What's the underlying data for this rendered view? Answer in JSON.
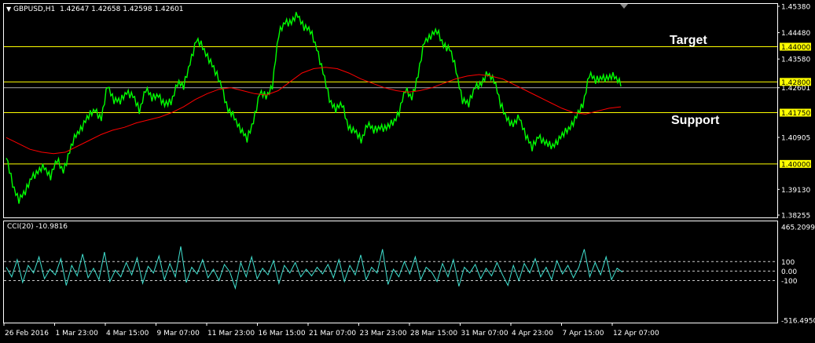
{
  "header": {
    "symbol": "GBPUSD,H1",
    "quotes": "1.42647 1.42658 1.42598 1.42601",
    "indicator": "CCI(20) -10.9816"
  },
  "annotations": {
    "target": "Target",
    "support": "Support"
  },
  "colors": {
    "price": "#00ff00",
    "ma": "#ff0000",
    "cci": "#40e0d0",
    "level": "#ffff00",
    "axis": "#ffffff"
  },
  "chart_data": {
    "type": "line",
    "x_labels": [
      "26 Feb 2016",
      "1 Mar 23:00",
      "4 Mar 15:00",
      "9 Mar 07:00",
      "11 Mar 23:00",
      "16 Mar 15:00",
      "21 Mar 07:00",
      "23 Mar 23:00",
      "28 Mar 15:00",
      "31 Mar 07:00",
      "4 Apr 23:00",
      "7 Apr 15:00",
      "12 Apr 07:00"
    ],
    "price_axis": {
      "ylim": [
        1.38255,
        1.4538
      ],
      "ticks": [
        "1.45380",
        "1.44480",
        "1.43580",
        "1.42601",
        "1.40905",
        "1.39130",
        "1.38255"
      ]
    },
    "levels": [
      {
        "value": 1.44,
        "label": "1.44000"
      },
      {
        "value": 1.428,
        "label": "1.42800"
      },
      {
        "value": 1.4175,
        "label": "1.41750"
      },
      {
        "value": 1.4,
        "label": "1.40000"
      }
    ],
    "current_price": {
      "value": 1.42601,
      "label": "1.42601"
    },
    "series": [
      {
        "name": "GBPUSD,H1",
        "values": [
          1.402,
          1.393,
          1.388,
          1.39,
          1.396,
          1.397,
          1.399,
          1.396,
          1.401,
          1.398,
          1.404,
          1.41,
          1.413,
          1.416,
          1.419,
          1.415,
          1.427,
          1.422,
          1.421,
          1.425,
          1.423,
          1.418,
          1.426,
          1.422,
          1.424,
          1.42,
          1.421,
          1.428,
          1.426,
          1.435,
          1.442,
          1.44,
          1.436,
          1.431,
          1.427,
          1.418,
          1.416,
          1.412,
          1.408,
          1.415,
          1.424,
          1.423,
          1.427,
          1.444,
          1.449,
          1.448,
          1.451,
          1.447,
          1.445,
          1.44,
          1.431,
          1.422,
          1.419,
          1.42,
          1.413,
          1.411,
          1.408,
          1.414,
          1.411,
          1.413,
          1.412,
          1.414,
          1.418,
          1.425,
          1.423,
          1.43,
          1.442,
          1.444,
          1.445,
          1.441,
          1.439,
          1.432,
          1.422,
          1.42,
          1.427,
          1.427,
          1.431,
          1.429,
          1.42,
          1.416,
          1.413,
          1.416,
          1.41,
          1.405,
          1.41,
          1.407,
          1.406,
          1.408,
          1.41,
          1.413,
          1.416,
          1.42,
          1.431,
          1.428,
          1.43,
          1.429,
          1.43,
          1.428
        ]
      },
      {
        "name": "MA",
        "values": [
          1.409,
          1.407,
          1.405,
          1.404,
          1.4035,
          1.404,
          1.406,
          1.408,
          1.41,
          1.4115,
          1.4125,
          1.414,
          1.415,
          1.416,
          1.4175,
          1.4195,
          1.422,
          1.424,
          1.4255,
          1.426,
          1.425,
          1.424,
          1.4235,
          1.425,
          1.428,
          1.431,
          1.4325,
          1.433,
          1.4325,
          1.431,
          1.429,
          1.4275,
          1.426,
          1.425,
          1.4245,
          1.425,
          1.426,
          1.4275,
          1.429,
          1.43,
          1.4305,
          1.43,
          1.429,
          1.427,
          1.425,
          1.423,
          1.421,
          1.419,
          1.4175,
          1.417,
          1.418,
          1.419,
          1.4195
        ]
      }
    ],
    "cci": {
      "name": "CCI(20)",
      "ylim": [
        -516.495,
        465.2099
      ],
      "ticks": [
        "465.2099",
        "100",
        "0.00",
        "-100",
        "-516.4950"
      ],
      "levels": [
        100,
        0,
        -100
      ],
      "values": [
        40,
        -60,
        120,
        -120,
        60,
        -20,
        150,
        -80,
        20,
        -40,
        130,
        -150,
        60,
        -50,
        180,
        -70,
        30,
        -90,
        200,
        -110,
        10,
        -60,
        90,
        -40,
        140,
        -130,
        50,
        -20,
        160,
        -90,
        80,
        -60,
        260,
        -120,
        40,
        -30,
        120,
        -70,
        20,
        -100,
        70,
        -10,
        -180,
        90,
        -60,
        150,
        -80,
        30,
        -40,
        110,
        -130,
        60,
        -20,
        90,
        -60,
        20,
        -50,
        40,
        -30,
        70,
        -70,
        120,
        -110,
        60,
        -40,
        170,
        -90,
        40,
        -20,
        230,
        -140,
        20,
        -60,
        100,
        -30,
        150,
        -90,
        40,
        -10,
        -110,
        80,
        -60,
        120,
        -160,
        40,
        -20,
        70,
        -80,
        30,
        -50,
        90,
        -40,
        -150,
        60,
        -100,
        80,
        -20,
        130,
        -60,
        40,
        -90,
        110,
        -30,
        60,
        -70,
        40,
        230,
        -60,
        90,
        -40,
        150,
        -90,
        30,
        -11
      ]
    }
  }
}
